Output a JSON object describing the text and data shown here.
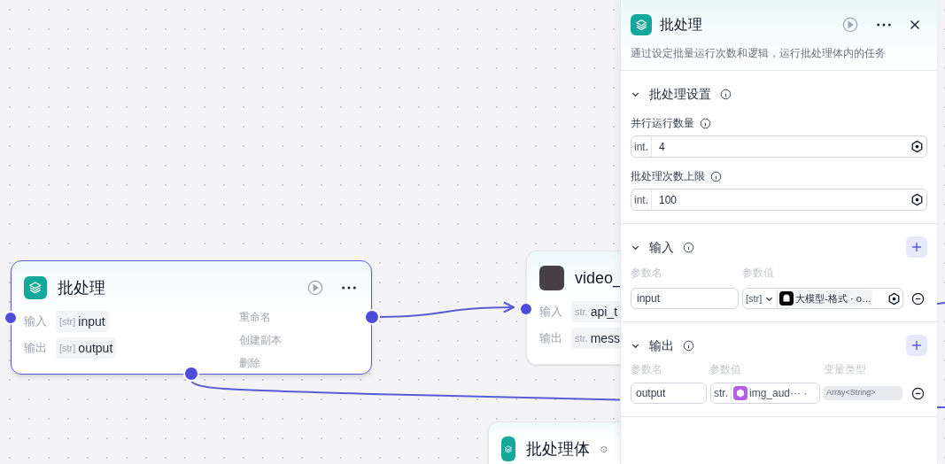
{
  "canvas": {
    "nodes": [
      {
        "kind": "batch",
        "title": "批处理",
        "selected": true,
        "rows": [
          {
            "label": "输入",
            "type": "[str]",
            "value": "input"
          },
          {
            "label": "输出",
            "type": "[str]",
            "value": "output"
          }
        ]
      },
      {
        "kind": "plugin",
        "title": "video_",
        "selected": false,
        "rows": [
          {
            "label": "输入",
            "type": "str.",
            "value": "api_t"
          },
          {
            "label": "输出",
            "type": "str.",
            "value": "mess"
          }
        ]
      },
      {
        "kind": "body",
        "title": "批处理体",
        "selected": false
      }
    ],
    "faded_menu": [
      "重命名",
      "创建副本",
      "删除"
    ]
  },
  "panel": {
    "title": "批处理",
    "description": "通过设定批量运行次数和逻辑，运行批处理体内的任务",
    "settings": {
      "title": "批处理设置",
      "expanded": true,
      "fields": [
        {
          "label": "并行运行数量",
          "type": "int.",
          "value": "4"
        },
        {
          "label": "批处理次数上限",
          "type": "int.",
          "value": "100"
        }
      ]
    },
    "inputs": {
      "title": "输入",
      "expanded": true,
      "columns": [
        "参数名",
        "参数值"
      ],
      "rows": [
        {
          "name": "input",
          "type": "[str]",
          "kind": "model",
          "ref": "大模型-格式 · o…"
        }
      ]
    },
    "outputs": {
      "title": "输出",
      "expanded": true,
      "columns": [
        "参数名",
        "参数值",
        "变量类型"
      ],
      "rows": [
        {
          "name": "output",
          "type": "str.",
          "kind": "plugin",
          "ref": "img_aud··· ·",
          "var_type": "Array<String>"
        }
      ]
    }
  }
}
